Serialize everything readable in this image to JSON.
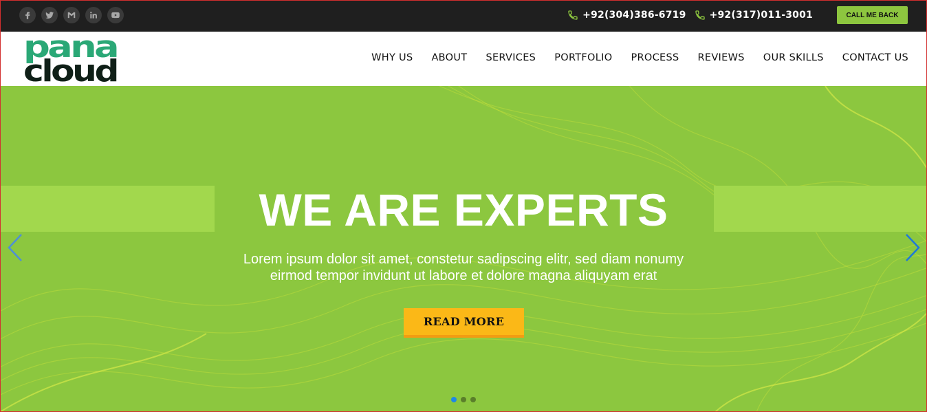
{
  "topbar": {
    "social": [
      {
        "icon": "facebook-icon"
      },
      {
        "icon": "twitter-icon"
      },
      {
        "icon": "gmail-icon"
      },
      {
        "icon": "linkedin-icon"
      },
      {
        "icon": "youtube-icon"
      }
    ],
    "phones": [
      "+92(304)386-6719",
      "+92(317)011-3001"
    ],
    "callback_label": "CALL ME BACK"
  },
  "logo": {
    "line1": "pana",
    "line2": "cloud"
  },
  "nav": [
    "WHY US",
    "ABOUT",
    "SERVICES",
    "PORTFOLIO",
    "PROCESS",
    "REVIEWS",
    "OUR SKILLS",
    "CONTACT US"
  ],
  "hero": {
    "title": "WE ARE EXPERTS",
    "subtitle_line1": "Lorem ipsum dolor sit amet, constetur sadipscing elitr, sed diam nonumy",
    "subtitle_line2": "eirmod tempor invidunt ut labore et dolore magna aliquyam erat",
    "button": "READ MORE",
    "slides": 3,
    "active_slide": 1
  },
  "colors": {
    "accent": "#8dc63f",
    "hero_bg": "#8cc73f",
    "button": "#fbb817",
    "topbar": "#1f1f1f",
    "logo_green": "#2aa876",
    "logo_dark": "#0f1f17"
  }
}
